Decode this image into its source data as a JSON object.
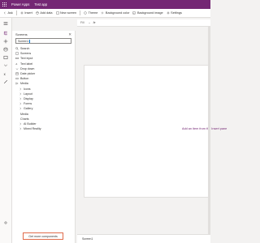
{
  "app": {
    "brand": "Power Apps",
    "title": "Test app"
  },
  "commandbar": {
    "items": [
      {
        "label": "Ask",
        "icon": "back-arrow-icon"
      },
      {
        "label": "Insert",
        "icon": "plus-icon"
      },
      {
        "label": "Add data",
        "icon": "database-icon"
      },
      {
        "label": "New screen",
        "icon": "screen-icon"
      },
      {
        "label": "Theme",
        "icon": "palette-icon"
      },
      {
        "label": "Background color",
        "icon": "paint-bucket-icon"
      },
      {
        "label": "Background image",
        "icon": "image-icon"
      },
      {
        "label": "Settings",
        "icon": "gear-icon"
      }
    ]
  },
  "formula": {
    "property": "Fill",
    "value": "fx"
  },
  "tree": {
    "title": "Screens",
    "search_value": "Screen1",
    "items": [
      {
        "label": "Search",
        "icon": "search-icon",
        "level": 0
      },
      {
        "label": "Screens",
        "icon": "screen-icon",
        "level": 0
      },
      {
        "label": "Text input",
        "icon": "textbox-icon",
        "level": 0
      },
      {
        "label": "Text label",
        "icon": "label-icon",
        "level": 0
      },
      {
        "label": "Drop down",
        "icon": "dropdown-icon",
        "level": 0
      },
      {
        "label": "Date picker",
        "icon": "calendar-icon",
        "level": 0
      },
      {
        "label": "Button",
        "icon": "button-icon",
        "level": 0
      },
      {
        "label": "Media",
        "icon": "media-icon",
        "level": 0
      },
      {
        "label": "Icons",
        "icon": "star-icon",
        "level": 1
      },
      {
        "label": "Layout",
        "icon": "layout-icon",
        "level": 1
      },
      {
        "label": "Display",
        "icon": "display-icon",
        "level": 1
      },
      {
        "label": "Forms",
        "icon": "form-icon",
        "level": 1
      },
      {
        "label": "Gallery",
        "icon": "gallery-icon",
        "level": 1
      },
      {
        "label": "Media",
        "icon": "media-icon",
        "level": 1
      },
      {
        "label": "Charts",
        "icon": "chart-icon",
        "level": 1
      },
      {
        "label": "AI Builder",
        "icon": "ai-icon",
        "level": 1
      },
      {
        "label": "Mixed Reality",
        "icon": "cube-icon",
        "level": 1
      }
    ]
  },
  "canvas": {
    "link_text": "Add an item from the Insert pane"
  },
  "bottom": {
    "button_label": "Get more components",
    "zoom": "Screen1"
  },
  "colors": {
    "brand": "#742774",
    "accent": "#0078d4",
    "highlight": "#e06c4b"
  }
}
